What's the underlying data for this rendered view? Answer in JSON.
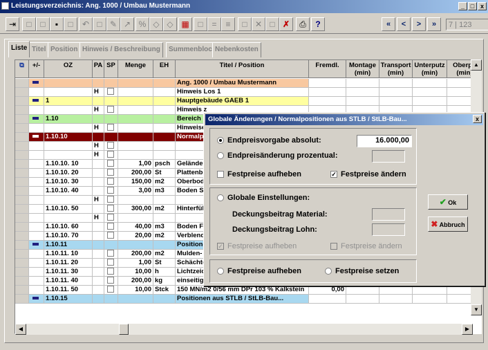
{
  "window": {
    "title": "Leistungsverzeichnis: Ang. 1000 / Umbau Mustermann",
    "min": "_",
    "max": "□",
    "close": "x"
  },
  "toolbar": {
    "page_indicator": "7 | 123",
    "nav_first": "«",
    "nav_prev": "<",
    "nav_next": ">",
    "nav_last": "»"
  },
  "tabs": [
    "Liste",
    "Titel",
    "Position",
    "Hinweis / Beschreibung",
    "Summenblock",
    "Nebenkosten"
  ],
  "grid": {
    "headers": [
      "+/-",
      "OZ",
      "PA",
      "SP",
      "Menge",
      "EH",
      "Titel / Position",
      "Fremdl.",
      "Montage (min)",
      "Transport (min)",
      "Unterputz (min)",
      "Oberpu (min)"
    ],
    "rows": [
      {
        "pm": "-",
        "oz": "",
        "pa": "",
        "sp": "",
        "menge": "",
        "eh": "",
        "titel": "Ang. 1000 / Umbau Mustermann",
        "fremdl": "",
        "bg": "#f8c8a0"
      },
      {
        "pm": "",
        "oz": "",
        "pa": "H",
        "sp": "box",
        "menge": "",
        "eh": "",
        "titel": "Hinweis Los 1",
        "fremdl": "",
        "bg": "#ffffff"
      },
      {
        "pm": "-",
        "oz": "1",
        "pa": "",
        "sp": "",
        "menge": "",
        "eh": "",
        "titel": "Hauptgebäude GAEB 1",
        "fremdl": "",
        "bg": "#ffffa0"
      },
      {
        "pm": "",
        "oz": "",
        "pa": "H",
        "sp": "box",
        "menge": "",
        "eh": "",
        "titel": "Hinweis z",
        "fremdl": "",
        "bg": "#ffffff"
      },
      {
        "pm": "-",
        "oz": "1.10",
        "pa": "",
        "sp": "",
        "menge": "",
        "eh": "",
        "titel": "Bereich 1",
        "fremdl": "",
        "bg": "#b8f0a0"
      },
      {
        "pm": "",
        "oz": "",
        "pa": "H",
        "sp": "box",
        "menge": "",
        "eh": "",
        "titel": "Hinweise",
        "fremdl": "",
        "bg": "#ffffff"
      },
      {
        "pm": "-",
        "oz": "1.10.10",
        "pa": "",
        "sp": "",
        "menge": "",
        "eh": "",
        "titel": "Normalpo",
        "fremdl": "",
        "bg": "#800000",
        "selected": true
      },
      {
        "pm": "",
        "oz": "",
        "pa": "H",
        "sp": "box",
        "menge": "",
        "eh": "",
        "titel": "",
        "fremdl": "",
        "bg": "#ffffff"
      },
      {
        "pm": "",
        "oz": "",
        "pa": "H",
        "sp": "box",
        "menge": "",
        "eh": "",
        "titel": "",
        "fremdl": "",
        "bg": "#ffffff"
      },
      {
        "pm": "",
        "oz": "1.10.10. 10",
        "pa": "",
        "sp": "box",
        "menge": "1,00",
        "eh": "psch",
        "titel": "Gelände",
        "fremdl": "",
        "bg": "#ffffff"
      },
      {
        "pm": "",
        "oz": "1.10.10. 20",
        "pa": "",
        "sp": "box",
        "menge": "200,00",
        "eh": "St",
        "titel": "Plattenbe",
        "fremdl": "",
        "bg": "#ffffff"
      },
      {
        "pm": "",
        "oz": "1.10.10. 30",
        "pa": "",
        "sp": "box",
        "menge": "150,00",
        "eh": "m2",
        "titel": "Oberbode",
        "fremdl": "",
        "bg": "#ffffff"
      },
      {
        "pm": "",
        "oz": "1.10.10. 40",
        "pa": "",
        "sp": "box",
        "menge": "3,00",
        "eh": "m3",
        "titel": "Boden Su",
        "fremdl": "",
        "bg": "#ffffff"
      },
      {
        "pm": "",
        "oz": "",
        "pa": "H",
        "sp": "box",
        "menge": "",
        "eh": "",
        "titel": "",
        "fremdl": "",
        "bg": "#ffffff"
      },
      {
        "pm": "",
        "oz": "1.10.10. 50",
        "pa": "",
        "sp": "box",
        "menge": "300,00",
        "eh": "m2",
        "titel": "Hinterfüll",
        "fremdl": "",
        "bg": "#ffffff"
      },
      {
        "pm": "",
        "oz": "",
        "pa": "H",
        "sp": "box",
        "menge": "",
        "eh": "",
        "titel": "",
        "fremdl": "",
        "bg": "#ffffff"
      },
      {
        "pm": "",
        "oz": "1.10.10. 60",
        "pa": "",
        "sp": "box",
        "menge": "40,00",
        "eh": "m3",
        "titel": "Boden Fu",
        "fremdl": "",
        "bg": "#ffffff"
      },
      {
        "pm": "",
        "oz": "1.10.10. 70",
        "pa": "",
        "sp": "box",
        "menge": "20,00",
        "eh": "m2",
        "titel": "Verblendu",
        "fremdl": "",
        "bg": "#ffffff"
      },
      {
        "pm": "-",
        "oz": "1.10.11",
        "pa": "",
        "sp": "",
        "menge": "",
        "eh": "",
        "titel": "Positionen",
        "fremdl": "",
        "bg": "#a8d8f0"
      },
      {
        "pm": "",
        "oz": "1.10.11. 10",
        "pa": "",
        "sp": "box",
        "menge": "200,00",
        "eh": "m2",
        "titel": "Mulden- u",
        "fremdl": "",
        "bg": "#ffffff"
      },
      {
        "pm": "",
        "oz": "1.10.11. 20",
        "pa": "",
        "sp": "box",
        "menge": "1,00",
        "eh": "St",
        "titel": "Schächte",
        "fremdl": "",
        "bg": "#ffffff"
      },
      {
        "pm": "",
        "oz": "1.10.11. 30",
        "pa": "",
        "sp": "box",
        "menge": "10,00",
        "eh": "h",
        "titel": "Lichtzeich",
        "fremdl": "",
        "bg": "#ffffff"
      },
      {
        "pm": "",
        "oz": "1.10.11. 40",
        "pa": "",
        "sp": "box",
        "menge": "200,00",
        "eh": "kg",
        "titel": "einseitig bearbe Schrauben verzink Gummi",
        "fremdl": "0,00",
        "bg": "#ffffff"
      },
      {
        "pm": "",
        "oz": "1.10.11. 50",
        "pa": "",
        "sp": "box",
        "menge": "10,00",
        "eh": "Stck",
        "titel": "150 MN/m2 0/56 mm DPr 103 % Kalkstein",
        "fremdl": "0,00",
        "bg": "#ffffff"
      },
      {
        "pm": "-",
        "oz": "1.10.15",
        "pa": "",
        "sp": "",
        "menge": "",
        "eh": "",
        "titel": "Positionen aus STLB / StLB-Bau...",
        "fremdl": "",
        "bg": "#a8d8f0"
      }
    ]
  },
  "dialog": {
    "title": "Globale Änderungen / Normalpositionen aus STLB / StLB-Bau...",
    "close": "x",
    "opt_absolut": "Endpreisvorgabe absolut:",
    "absolut_value": "16.000,00",
    "opt_prozentual": "Endpreisänderung prozentual:",
    "prozentual_value": "",
    "cb_festpreise_aufheben": "Festpreise aufheben",
    "cb_festpreise_aendern": "Festpreise ändern",
    "opt_global": "Globale Einstellungen:",
    "label_material": "Deckungsbeitrag Material:",
    "label_lohn": "Deckungsbeitrag Lohn:",
    "cb_dis_aufheben": "Festpreise aufheben",
    "cb_dis_aendern": "Festpreise ändern",
    "opt_bottom_aufheben": "Festpreise aufheben",
    "opt_bottom_setzen": "Festpreise setzen",
    "ok_label": "Ok",
    "cancel_label": "Abbruch"
  }
}
